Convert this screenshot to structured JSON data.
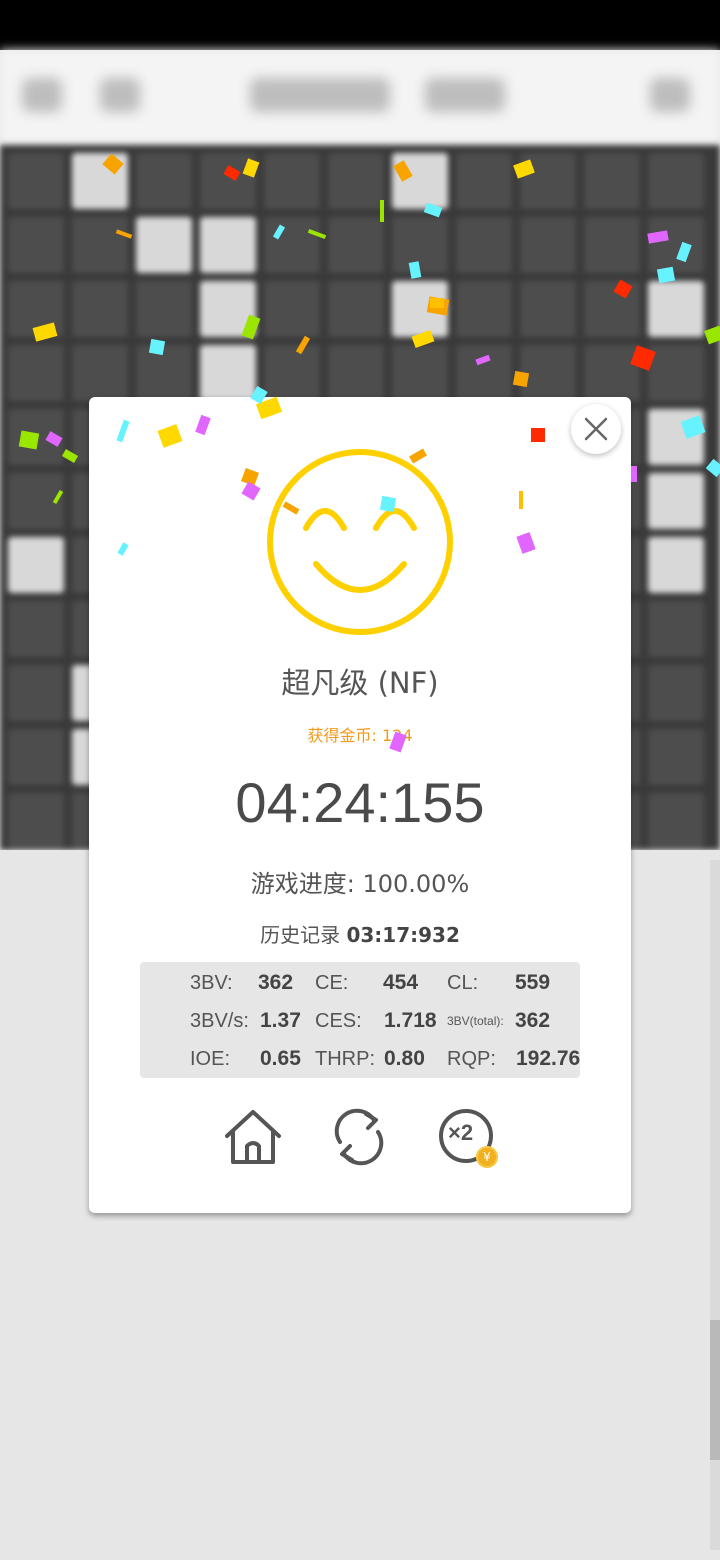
{
  "dialog": {
    "close_icon": "close-icon",
    "face_icon": "smiley-face-icon",
    "rank_label": "超凡级 (NF)",
    "coins_label": "获得金币: 124",
    "time": "04:24:155",
    "progress_label": "游戏进度: 100.00%",
    "history_label": "历史记录",
    "history_value": "03:17:932",
    "stats": {
      "bbbv_label": "3BV:",
      "bbbv_value": "362",
      "ce_label": "CE:",
      "ce_value": "454",
      "cl_label": "CL:",
      "cl_value": "559",
      "bbbvs_label": "3BV/s:",
      "bbbvs_value": "1.37",
      "ces_label": "CES:",
      "ces_value": "1.718",
      "bbbv_total_label": "3BV(total):",
      "bbbv_total_value": "362",
      "ioe_label": "IOE:",
      "ioe_value": "0.65",
      "thrp_label": "THRP:",
      "thrp_value": "0.80",
      "rqp_label": "RQP:",
      "rqp_value": "192.76"
    },
    "actions": {
      "home_icon": "home-icon",
      "restart_icon": "restart-icon",
      "double_icon": "double-coins-icon",
      "double_label": "×2",
      "coin_symbol": "¥"
    }
  },
  "colors": {
    "face": "#FFD000",
    "coins_text": "#F29A1A",
    "stats_bg": "#E6E6E6"
  }
}
